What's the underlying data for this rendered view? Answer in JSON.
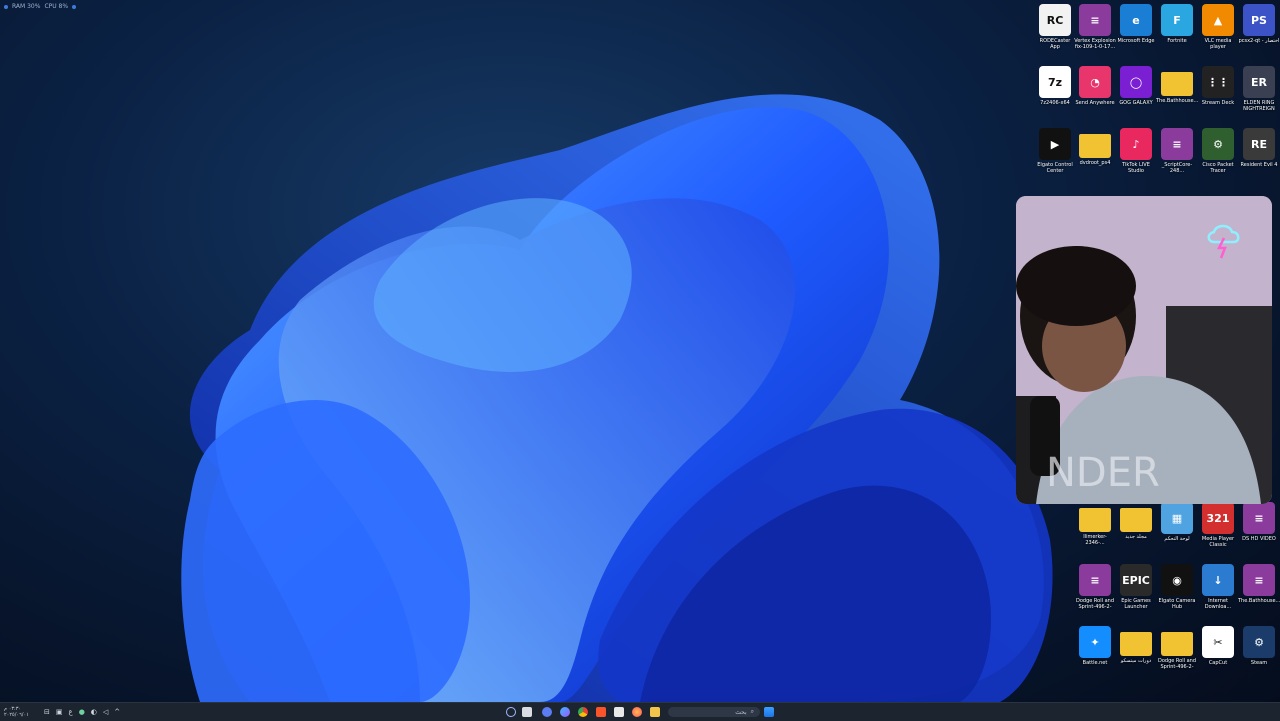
{
  "perf_overlay": {
    "ram": "RAM 30%",
    "cpu": "CPU 8%"
  },
  "desktop_icons": [
    {
      "label": "RODECaster App",
      "color": "#f2f2f2",
      "glyph": "RC",
      "glyph_color": "#111"
    },
    {
      "label": "Vertex Explosion fix-109-1-0-17...",
      "color": "#8a3b9c",
      "glyph": "≡"
    },
    {
      "label": "Microsoft Edge",
      "color": "#1a7fd4",
      "glyph": "e"
    },
    {
      "label": "Fortnite",
      "color": "#2aa6e0",
      "glyph": "F"
    },
    {
      "label": "VLC media player",
      "color": "#f18a00",
      "glyph": "▲"
    },
    {
      "label": "pcsx2-qt - اختصار",
      "color": "#3c53c8",
      "glyph": "PS"
    },
    {
      "label": "7z2406-x64",
      "color": "#ffffff",
      "glyph": "7z",
      "glyph_color": "#111"
    },
    {
      "label": "Send Anywhere",
      "color": "#e8356b",
      "glyph": "◔"
    },
    {
      "label": "GOG GALAXY",
      "color": "#7a1fd1",
      "glyph": "◯"
    },
    {
      "label": "The.Bathhouse...",
      "color": "#f1c232",
      "glyph": ""
    },
    {
      "label": "Stream Deck",
      "color": "#222222",
      "glyph": "⋮⋮"
    },
    {
      "label": "ELDEN RING NIGHTREIGN",
      "color": "#3a3f52",
      "glyph": "ER"
    },
    {
      "label": "Elgato Control Center",
      "color": "#111111",
      "glyph": "▶"
    },
    {
      "label": "dvdroot_ps4",
      "color": "#f1c232",
      "glyph": ""
    },
    {
      "label": "TikTok LIVE Studio",
      "color": "#e9285f",
      "glyph": "♪"
    },
    {
      "label": "_ScriptCore-248...",
      "color": "#8a3b9c",
      "glyph": "≡"
    },
    {
      "label": "Cisco Packet Tracer",
      "color": "#2f5e2f",
      "glyph": "⚙"
    },
    {
      "label": "Resident Evil 4",
      "color": "#3a3a3a",
      "glyph": "RE"
    },
    {
      "label": "Ilimerker-2346-...",
      "color": "#f1c232",
      "glyph": ""
    },
    {
      "label": "مجلد جديد",
      "color": "#f1c232",
      "glyph": ""
    },
    {
      "label": "لوحة التحكم",
      "color": "#4fa3e0",
      "glyph": "▦"
    },
    {
      "label": "Media Player Classic",
      "color": "#d32f2f",
      "glyph": "321"
    },
    {
      "label": "DS HD VIDEO",
      "color": "#8a3b9c",
      "glyph": "≡"
    },
    {
      "label": "Dodge Roll and Sprint-496-2-30...",
      "color": "#8a3b9c",
      "glyph": "≡"
    },
    {
      "label": "Epic Games Launcher",
      "color": "#2a2a2a",
      "glyph": "EPIC"
    },
    {
      "label": "Elgato Camera Hub",
      "color": "#111111",
      "glyph": "◉"
    },
    {
      "label": "Internet Downloa...",
      "color": "#2b7bd1",
      "glyph": "↓"
    },
    {
      "label": "The.Bathhouse...",
      "color": "#8a3b9c",
      "glyph": "≡"
    },
    {
      "label": "Battle.net",
      "color": "#148eff",
      "glyph": "✦"
    },
    {
      "label": "دورات ميتسكو",
      "color": "#f1c232",
      "glyph": ""
    },
    {
      "label": "Dodge Roll and Sprint-496-2-30...",
      "color": "#f1c232",
      "glyph": ""
    },
    {
      "label": "CapCut",
      "color": "#ffffff",
      "glyph": "✂",
      "glyph_color": "#111"
    },
    {
      "label": "Steam",
      "color": "#1b3c6a",
      "glyph": "⚙"
    }
  ],
  "taskbar": {
    "search_placeholder": "بحث",
    "clock_time": "٠٣:٣٠ م",
    "clock_date": "٢٠٢٥/٠٦/٠١",
    "lang": "ع",
    "apps": [
      "widgets",
      "file-manager",
      "chat",
      "copilot",
      "chrome",
      "brave",
      "app",
      "firefox",
      "file-explorer",
      "start"
    ]
  }
}
